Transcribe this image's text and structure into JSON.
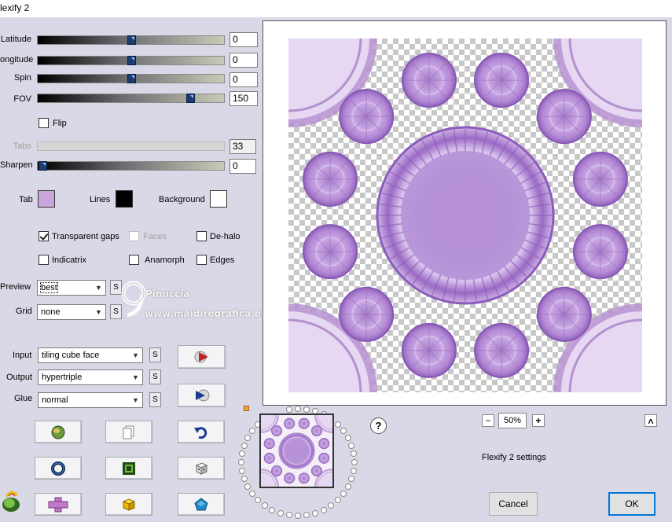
{
  "window": {
    "title": "lexify 2"
  },
  "sliders": [
    {
      "label": "Latitude",
      "value": "0",
      "position": 0.5
    },
    {
      "label": "ongitude",
      "value": "0",
      "position": 0.5
    },
    {
      "label": "Spin",
      "value": "0",
      "position": 0.5
    },
    {
      "label": "FOV",
      "value": "150",
      "position": 0.81
    }
  ],
  "flip": {
    "label": "Flip",
    "checked": false
  },
  "tabs": {
    "label": "Tabs",
    "value": "33",
    "enabled": false
  },
  "sharpen": {
    "label": "Sharpen",
    "value": "0",
    "position": 0.0
  },
  "colors": {
    "tab_label": "Tab",
    "tab_color": "#c9a6dc",
    "lines_label": "Lines",
    "lines_color": "#000000",
    "background_label": "Background",
    "background_color": "#ffffff"
  },
  "options": {
    "transparent_gaps": "Transparent gaps",
    "faces": "Faces",
    "dehalo": "De-halo",
    "indicatrix": "Indicatrix",
    "anamorph": "Anamorph",
    "edges": "Edges"
  },
  "preview": {
    "label": "Preview",
    "value": "best"
  },
  "grid": {
    "label": "Grid",
    "value": "none"
  },
  "input": {
    "label": "Input",
    "value": "tiling cube face"
  },
  "output": {
    "label": "Output",
    "value": "hypertriple"
  },
  "glue": {
    "label": "Glue",
    "value": "normal"
  },
  "s_label": "S",
  "watermark": {
    "name": "Pinuccia",
    "url": "www.maidiregrafica.eu"
  },
  "zoom": {
    "minus": "−",
    "value": "50%",
    "plus": "+",
    "up": "˄"
  },
  "help": "?",
  "settings_label": "Flexify 2 settings",
  "buttons": {
    "cancel": "Cancel",
    "ok": "OK"
  },
  "accent": "#0078d7",
  "purple": "#b58fd0",
  "icons": [
    "play-right-icon",
    "play-split-icon",
    "globe-icon",
    "copy-icon",
    "undo-icon",
    "ring-icon",
    "square-frame-icon",
    "dice-icon",
    "flower-icon",
    "cross-icon",
    "cube-icon",
    "pentagon-icon"
  ]
}
